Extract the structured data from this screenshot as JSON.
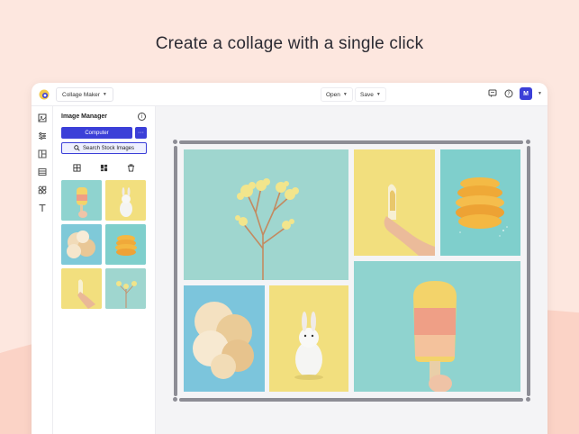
{
  "headline": "Create a collage with a single click",
  "topbar": {
    "app_name": "Collage Maker",
    "open_label": "Open",
    "save_label": "Save",
    "avatar_initial": "M"
  },
  "panel": {
    "title": "Image Manager",
    "upload_label": "Computer",
    "more_label": "···",
    "stock_label": "Search Stock Images"
  },
  "colors": {
    "accent": "#3b3fd8",
    "background": "#fde7df",
    "teal": "#8fd3cf",
    "yellow": "#f2df7e"
  }
}
